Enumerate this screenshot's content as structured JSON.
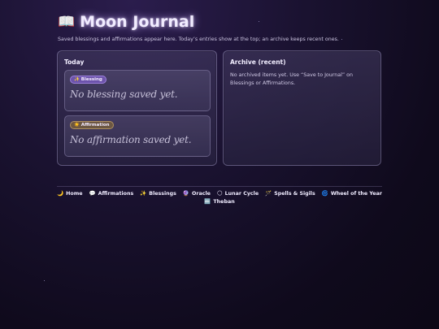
{
  "header": {
    "title": "Moon Journal",
    "title_icon": "open-book-icon",
    "subtitle": "Saved blessings and affirmations appear here. Today’s entries show at the top; an archive keeps recent ones."
  },
  "today": {
    "title": "Today",
    "blessing": {
      "badge_icon": "✨",
      "badge_label": "Blessing",
      "text": "No blessing saved yet."
    },
    "affirmation": {
      "badge_icon": "☀️",
      "badge_label": "Affirmation",
      "text": "No affirmation saved yet."
    }
  },
  "archive": {
    "title": "Archive (recent)",
    "empty_text": "No archived items yet. Use “Save to Journal” on Blessings or Affirmations."
  },
  "nav": {
    "items": [
      {
        "icon": "🌙",
        "label": "Home"
      },
      {
        "icon": "💬",
        "label": "Affirmations"
      },
      {
        "icon": "✨",
        "label": "Blessings"
      },
      {
        "icon": "🔮",
        "label": "Oracle"
      },
      {
        "icon": "🌕",
        "label": "Lunar Cycle"
      },
      {
        "icon": "🪄",
        "label": "Spells & Sigils"
      },
      {
        "icon": "🌀",
        "label": "Wheel of the Year"
      },
      {
        "icon": "🔤",
        "label": "Theban"
      }
    ]
  },
  "colors": {
    "background": "#120c22",
    "title_glow": "#c8aaff",
    "blessing_badge": "#785abe",
    "affirmation_badge": "#785f3c"
  }
}
